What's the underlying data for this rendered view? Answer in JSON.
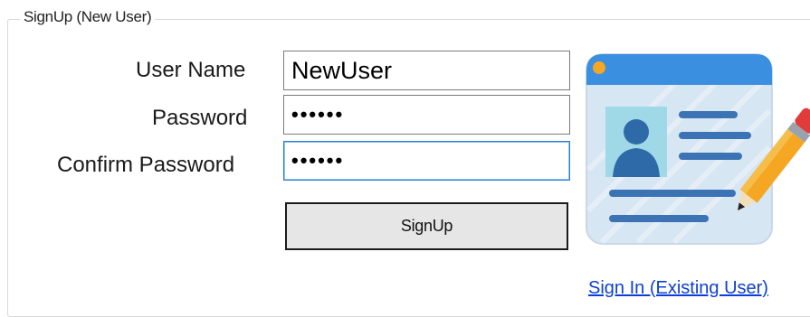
{
  "group": {
    "title": "SignUp (New User)"
  },
  "form": {
    "username_label": "User Name",
    "username_value": "NewUser",
    "password_label": "Password",
    "password_value": "••••••",
    "confirm_label": "Confirm Password",
    "confirm_value": "••••••"
  },
  "actions": {
    "signup_label": "SignUp",
    "signin_link": "Sign In (Existing User)"
  },
  "illustration": {
    "icon": "user-profile-card-with-pencil-icon"
  },
  "colors": {
    "focus_border": "#2d7fc9",
    "link": "#0b3fd6",
    "button_bg": "#e6e6e6",
    "card_header": "#3b8fe0",
    "card_body": "#d7e6f3",
    "avatar_bg": "#9fd8e6",
    "pencil": "#f5a623"
  }
}
